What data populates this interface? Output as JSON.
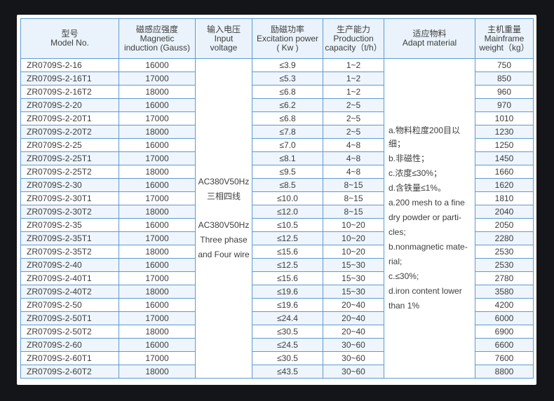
{
  "headers": {
    "model": {
      "zh": "型号",
      "en": "Model No."
    },
    "induction": {
      "zh": "磁感应强度",
      "en1": "Magnetic",
      "en2": "induction (Gauss)"
    },
    "voltage": {
      "zh": "输入电压",
      "en1": "Input",
      "en2": "voltage"
    },
    "power": {
      "zh": "励磁功率",
      "en1": "Excitation power",
      "en2": "( Kw )"
    },
    "capacity": {
      "zh": "生产能力",
      "en1": "Production",
      "en2": "capacity（t/h）"
    },
    "material": {
      "zh": "适应物料",
      "en": "Adapt material"
    },
    "weight": {
      "zh": "主机重量",
      "en1": "Mainframe",
      "en2": "weight（kg）"
    }
  },
  "voltage_text": {
    "line1": "AC380V50Hz",
    "line2": "三相四线",
    "line3": "AC380V50Hz",
    "line4": "Three phase",
    "line5": "and Four wire"
  },
  "material_text": [
    "a.物料粒度200目以细；",
    "b.非磁性；",
    "c.浓度≤30%；",
    "d.含铁量≤1%。",
    "a.200 mesh to a fine",
    "dry powder or parti-",
    "cles;",
    "b.nonmagnetic mate-",
    "rial;",
    "c.≤30%;",
    "d.iron content lower",
    "than 1%"
  ],
  "rows": [
    {
      "model": "ZR0709S-2-16",
      "induction": "16000",
      "power": "≤3.9",
      "capacity": "1~2",
      "weight": "750"
    },
    {
      "model": "ZR0709S-2-16T1",
      "induction": "17000",
      "power": "≤5.3",
      "capacity": "1~2",
      "weight": "850"
    },
    {
      "model": "ZR0709S-2-16T2",
      "induction": "18000",
      "power": "≤6.8",
      "capacity": "1~2",
      "weight": "960"
    },
    {
      "model": "ZR0709S-2-20",
      "induction": "16000",
      "power": "≤6.2",
      "capacity": "2~5",
      "weight": "970"
    },
    {
      "model": "ZR0709S-2-20T1",
      "induction": "17000",
      "power": "≤6.8",
      "capacity": "2~5",
      "weight": "1010"
    },
    {
      "model": "ZR0709S-2-20T2",
      "induction": "18000",
      "power": "≤7.8",
      "capacity": "2~5",
      "weight": "1230"
    },
    {
      "model": "ZR0709S-2-25",
      "induction": "16000",
      "power": "≤7.0",
      "capacity": "4~8",
      "weight": "1250"
    },
    {
      "model": "ZR0709S-2-25T1",
      "induction": "17000",
      "power": "≤8.1",
      "capacity": "4~8",
      "weight": "1450"
    },
    {
      "model": "ZR0709S-2-25T2",
      "induction": "18000",
      "power": "≤9.5",
      "capacity": "4~8",
      "weight": "1660"
    },
    {
      "model": "ZR0709S-2-30",
      "induction": "16000",
      "power": "≤8.5",
      "capacity": "8~15",
      "weight": "1620"
    },
    {
      "model": "ZR0709S-2-30T1",
      "induction": "17000",
      "power": "≤10.0",
      "capacity": "8~15",
      "weight": "1810"
    },
    {
      "model": "ZR0709S-2-30T2",
      "induction": "18000",
      "power": "≤12.0",
      "capacity": "8~15",
      "weight": "2040"
    },
    {
      "model": "ZR0709S-2-35",
      "induction": "16000",
      "power": "≤10.5",
      "capacity": "10~20",
      "weight": "2050"
    },
    {
      "model": "ZR0709S-2-35T1",
      "induction": "17000",
      "power": "≤12.5",
      "capacity": "10~20",
      "weight": "2280"
    },
    {
      "model": "ZR0709S-2-35T2",
      "induction": "18000",
      "power": "≤15.6",
      "capacity": "10~20",
      "weight": "2530"
    },
    {
      "model": "ZR0709S-2-40",
      "induction": "16000",
      "power": "≤12.5",
      "capacity": "15~30",
      "weight": "2530"
    },
    {
      "model": "ZR0709S-2-40T1",
      "induction": "17000",
      "power": "≤15.6",
      "capacity": "15~30",
      "weight": "2780"
    },
    {
      "model": "ZR0709S-2-40T2",
      "induction": "18000",
      "power": "≤19.6",
      "capacity": "15~30",
      "weight": "3580"
    },
    {
      "model": "ZR0709S-2-50",
      "induction": "16000",
      "power": "≤19.6",
      "capacity": "20~40",
      "weight": "4200"
    },
    {
      "model": "ZR0709S-2-50T1",
      "induction": "17000",
      "power": "≤24.4",
      "capacity": "20~40",
      "weight": "6000"
    },
    {
      "model": "ZR0709S-2-50T2",
      "induction": "18000",
      "power": "≤30.5",
      "capacity": "20~40",
      "weight": "6900"
    },
    {
      "model": "ZR0709S-2-60",
      "induction": "16000",
      "power": "≤24.5",
      "capacity": "30~60",
      "weight": "6600"
    },
    {
      "model": "ZR0709S-2-60T1",
      "induction": "17000",
      "power": "≤30.5",
      "capacity": "30~60",
      "weight": "7600"
    },
    {
      "model": "ZR0709S-2-60T2",
      "induction": "18000",
      "power": "≤43.5",
      "capacity": "30~60",
      "weight": "8800"
    }
  ]
}
